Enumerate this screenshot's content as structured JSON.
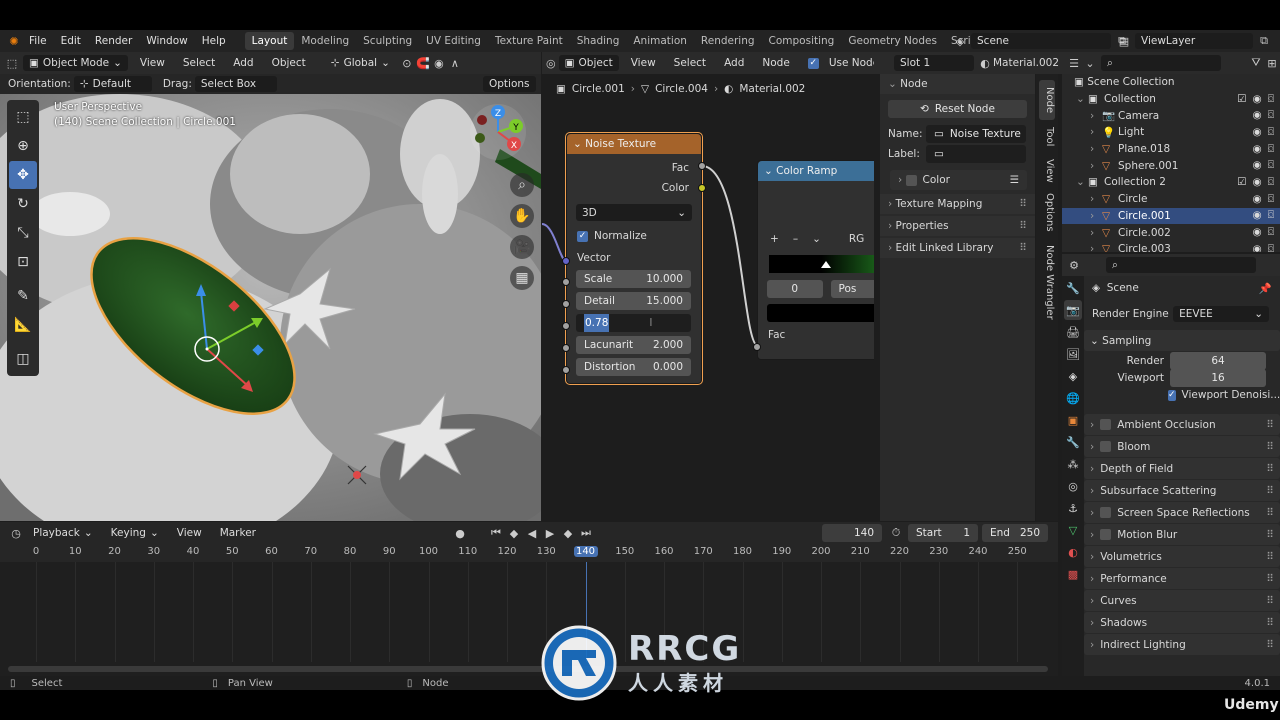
{
  "menu": {
    "items": [
      "File",
      "Edit",
      "Render",
      "Window",
      "Help"
    ],
    "workspaces": [
      "Layout",
      "Modeling",
      "Sculpting",
      "UV Editing",
      "Texture Paint",
      "Shading",
      "Animation",
      "Rendering",
      "Compositing",
      "Geometry Nodes",
      "Scripting"
    ],
    "active_workspace": "Layout",
    "add_tab": "+",
    "scene": "Scene",
    "view_layer": "ViewLayer"
  },
  "viewport": {
    "mode": "Object Mode",
    "menus": [
      "View",
      "Select",
      "Add",
      "Object"
    ],
    "transform": "Global",
    "orientation_label": "Orientation:",
    "orientation_value": "Default",
    "drag_label": "Drag:",
    "drag_value": "Select Box",
    "options": "Options",
    "info_line1": "User Perspective",
    "info_line2": "(140) Scene Collection | Circle.001",
    "gizmo": {
      "z": "Z",
      "y": "Y",
      "x": "X"
    }
  },
  "node_editor": {
    "type": "Object",
    "menus": [
      "View",
      "Select",
      "Add",
      "Node"
    ],
    "use_nodes": "Use Nodes",
    "slot": "Slot 1",
    "material": "Material.002",
    "breadcrumb": [
      "Circle.001",
      "Circle.004",
      "Material.002"
    ],
    "noise": {
      "title": "Noise Texture",
      "out_fac": "Fac",
      "out_color": "Color",
      "dimensions": "3D",
      "normalize": "Normalize",
      "vector": "Vector",
      "scale_label": "Scale",
      "scale_value": "10.000",
      "detail_label": "Detail",
      "detail_value": "15.000",
      "editing_value": "0.78",
      "lacunarity_label": "Lacunarit",
      "lacunarity_value": "2.000",
      "distortion_label": "Distortion",
      "distortion_value": "0.000"
    },
    "ramp": {
      "title": "Color Ramp",
      "interp": "RG",
      "pos_index": "0",
      "pos_label": "Pos",
      "in_fac": "Fac"
    }
  },
  "npanel": {
    "section": "Node",
    "reset": "Reset Node",
    "name_label": "Name:",
    "name_value": "Noise Texture",
    "label_label": "Label:",
    "color": "Color",
    "subsections": [
      "Texture Mapping",
      "Properties",
      "Edit Linked Library"
    ],
    "tabs": [
      "Node",
      "Tool",
      "View",
      "Options",
      "Node Wrangler"
    ]
  },
  "outliner": {
    "root": "Scene Collection",
    "rows": [
      {
        "name": "Collection",
        "indent": 1,
        "kind": "collection"
      },
      {
        "name": "Camera",
        "indent": 2,
        "kind": "camera"
      },
      {
        "name": "Light",
        "indent": 2,
        "kind": "light"
      },
      {
        "name": "Plane.018",
        "indent": 2,
        "kind": "mesh"
      },
      {
        "name": "Sphere.001",
        "indent": 2,
        "kind": "mesh"
      },
      {
        "name": "Collection 2",
        "indent": 1,
        "kind": "collection"
      },
      {
        "name": "Circle",
        "indent": 2,
        "kind": "mesh"
      },
      {
        "name": "Circle.001",
        "indent": 2,
        "kind": "mesh",
        "selected": true
      },
      {
        "name": "Circle.002",
        "indent": 2,
        "kind": "mesh"
      },
      {
        "name": "Circle.003",
        "indent": 2,
        "kind": "mesh"
      }
    ]
  },
  "properties": {
    "scene": "Scene",
    "render_engine_label": "Render Engine",
    "render_engine": "EEVEE",
    "sampling": "Sampling",
    "render_label": "Render",
    "render_value": "64",
    "viewport_label": "Viewport",
    "viewport_value": "16",
    "viewport_denoise": "Viewport Denoisi...",
    "sections": [
      {
        "name": "Ambient Occlusion",
        "check": true
      },
      {
        "name": "Bloom",
        "check": true
      },
      {
        "name": "Depth of Field",
        "check": false
      },
      {
        "name": "Subsurface Scattering",
        "check": false
      },
      {
        "name": "Screen Space Reflections",
        "check": true
      },
      {
        "name": "Motion Blur",
        "check": true
      },
      {
        "name": "Volumetrics",
        "check": false
      },
      {
        "name": "Performance",
        "check": false
      },
      {
        "name": "Curves",
        "check": false
      },
      {
        "name": "Shadows",
        "check": false
      },
      {
        "name": "Indirect Lighting",
        "check": false
      }
    ]
  },
  "timeline": {
    "menus": [
      "Playback",
      "Keying",
      "View",
      "Marker"
    ],
    "current_frame": "140",
    "start_label": "Start",
    "start_value": "1",
    "end_label": "End",
    "end_value": "250",
    "ticks": [
      "0",
      "10",
      "20",
      "30",
      "40",
      "50",
      "60",
      "70",
      "80",
      "90",
      "100",
      "110",
      "120",
      "130",
      "140",
      "150",
      "160",
      "170",
      "180",
      "190",
      "200",
      "210",
      "220",
      "230",
      "240",
      "250"
    ],
    "playhead": "140"
  },
  "status": {
    "select": "Select",
    "pan": "Pan View",
    "node": "Node",
    "version": "4.0.1"
  },
  "watermark": {
    "brand": "RRCG",
    "sub": "人人素材"
  },
  "udemy": "Udemy",
  "colors": {
    "accent": "#4772b3",
    "noise_header": "#a5632a",
    "ramp_header": "#3c6f97",
    "selected_row": "#334d80"
  }
}
